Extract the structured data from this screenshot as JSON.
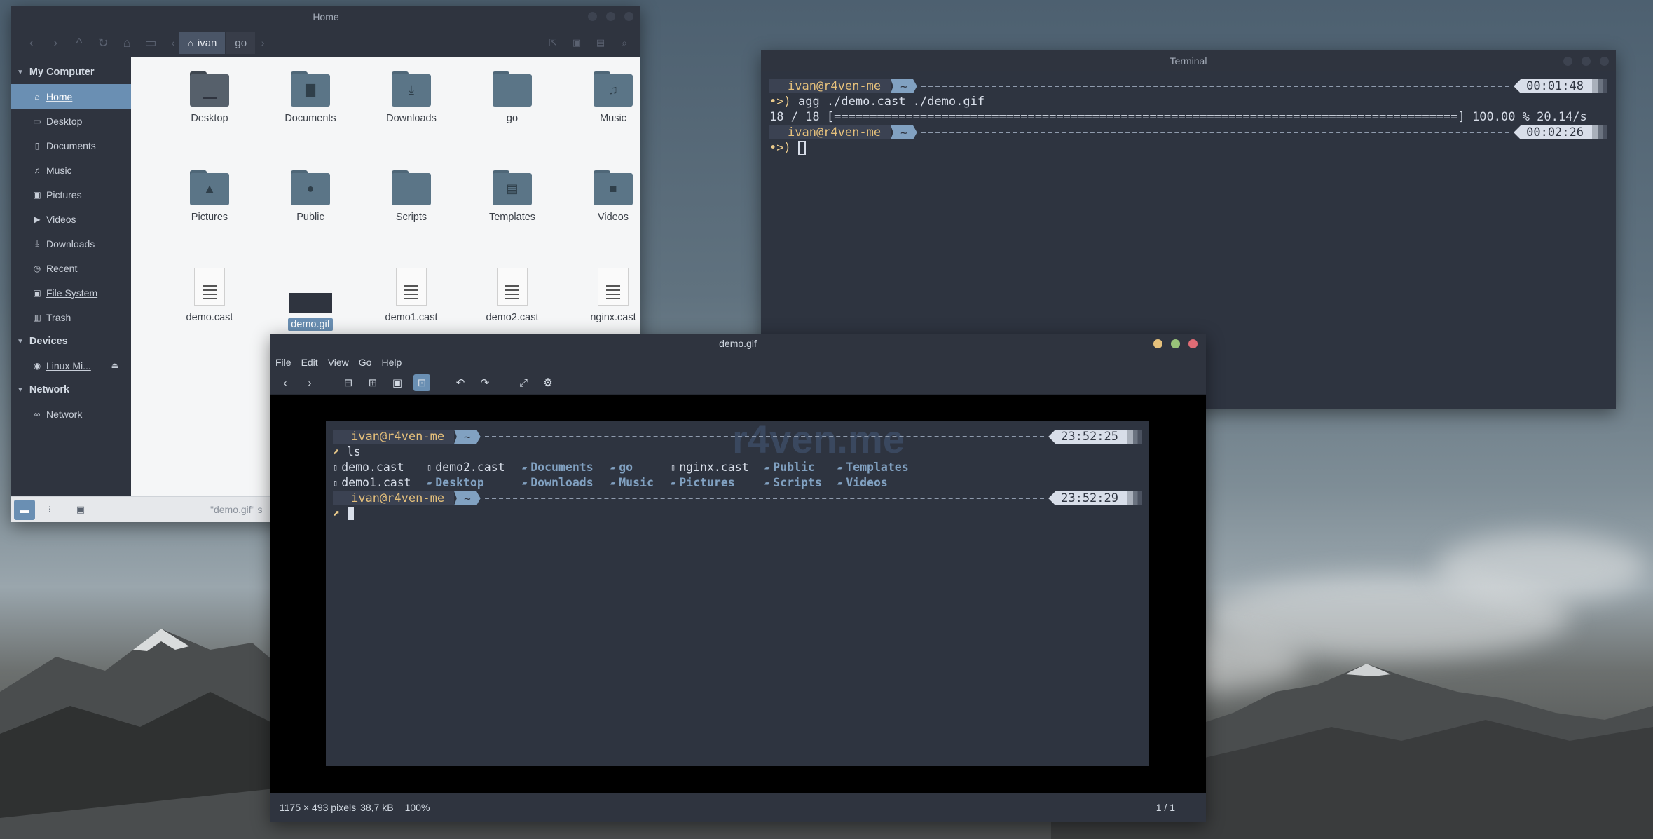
{
  "file_manager": {
    "title": "Home",
    "breadcrumbs": [
      "ivan",
      "go"
    ],
    "sidebar": {
      "sections": [
        {
          "header": "My Computer",
          "items": [
            {
              "label": "Home",
              "icon": "home-icon",
              "active": true
            },
            {
              "label": "Desktop",
              "icon": "folder-icon"
            },
            {
              "label": "Documents",
              "icon": "document-icon"
            },
            {
              "label": "Music",
              "icon": "music-icon"
            },
            {
              "label": "Pictures",
              "icon": "picture-icon"
            },
            {
              "label": "Videos",
              "icon": "video-icon"
            },
            {
              "label": "Downloads",
              "icon": "download-icon"
            },
            {
              "label": "Recent",
              "icon": "recent-icon"
            },
            {
              "label": "File System",
              "icon": "drive-icon"
            },
            {
              "label": "Trash",
              "icon": "trash-icon"
            }
          ]
        },
        {
          "header": "Devices",
          "items": [
            {
              "label": "Linux Mi...",
              "icon": "disc-icon"
            }
          ]
        },
        {
          "header": "Network",
          "items": [
            {
              "label": "Network",
              "icon": "network-icon"
            }
          ]
        }
      ]
    },
    "items": [
      {
        "label": "Desktop",
        "kind": "folder-dark",
        "glyph": ""
      },
      {
        "label": "Documents",
        "kind": "folder",
        "glyph": "▇"
      },
      {
        "label": "Downloads",
        "kind": "folder",
        "glyph": "⤓"
      },
      {
        "label": "go",
        "kind": "folder",
        "glyph": ""
      },
      {
        "label": "Music",
        "kind": "folder",
        "glyph": "♫"
      },
      {
        "label": "Pictures",
        "kind": "folder",
        "glyph": "▲"
      },
      {
        "label": "Public",
        "kind": "folder",
        "glyph": "●"
      },
      {
        "label": "Scripts",
        "kind": "folder",
        "glyph": ""
      },
      {
        "label": "Templates",
        "kind": "folder",
        "glyph": "▤"
      },
      {
        "label": "Videos",
        "kind": "folder",
        "glyph": "■"
      },
      {
        "label": "demo.cast",
        "kind": "doc"
      },
      {
        "label": "demo.gif",
        "kind": "image",
        "selected": true
      },
      {
        "label": "demo1.cast",
        "kind": "doc"
      },
      {
        "label": "demo2.cast",
        "kind": "doc"
      },
      {
        "label": "nginx.cast",
        "kind": "doc"
      }
    ],
    "status_text": "\"demo.gif\" s"
  },
  "terminal": {
    "title": "Terminal",
    "user_host": "ivan@r4ven-me",
    "tilde": "~",
    "time1": "00:01:48",
    "command": "agg ./demo.cast ./demo.gif",
    "progress": "18 / 18 [=======================================================================================] 100.00 % 20.14/s",
    "time2": "00:02:26"
  },
  "viewer": {
    "title": "demo.gif",
    "menu": [
      "File",
      "Edit",
      "View",
      "Go",
      "Help"
    ],
    "gif": {
      "watermark": "r4ven.me",
      "user_host": "ivan@r4ven-me",
      "tilde": "~",
      "time1": "23:52:25",
      "command": "ls",
      "ls_rows": [
        [
          {
            "name": "demo.cast",
            "dir": false
          },
          {
            "name": "demo2.cast",
            "dir": false
          },
          {
            "name": "Documents",
            "dir": true
          },
          {
            "name": "go",
            "dir": true
          },
          {
            "name": "nginx.cast",
            "dir": false
          },
          {
            "name": "Public",
            "dir": true
          },
          {
            "name": "Templates",
            "dir": true
          }
        ],
        [
          {
            "name": "demo1.cast",
            "dir": false
          },
          {
            "name": "Desktop",
            "dir": true
          },
          {
            "name": "Downloads",
            "dir": true
          },
          {
            "name": "Music",
            "dir": true
          },
          {
            "name": "Pictures",
            "dir": true
          },
          {
            "name": "Scripts",
            "dir": true
          },
          {
            "name": "Videos",
            "dir": true
          }
        ]
      ],
      "time2": "23:52:29"
    },
    "status": {
      "dimensions": "1175 × 493 pixels",
      "size": "38,7 kB",
      "zoom": "100%",
      "page": "1 / 1"
    }
  }
}
